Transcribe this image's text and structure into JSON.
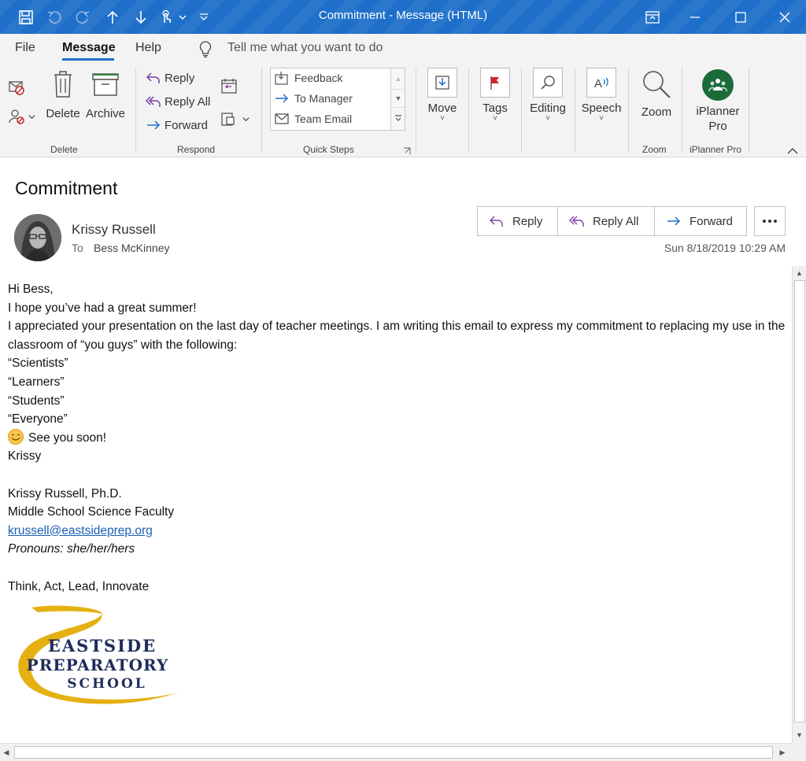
{
  "window": {
    "title": "Commitment  -  Message (HTML)",
    "accent": "#1e6fc9"
  },
  "menu": {
    "tabs": [
      "File",
      "Message",
      "Help"
    ],
    "active_tab": "Message",
    "tell_me_placeholder": "Tell me what you want to do"
  },
  "ribbon": {
    "delete_group": {
      "label": "Delete",
      "delete_label": "Delete",
      "archive_label": "Archive"
    },
    "respond_group": {
      "label": "Respond",
      "reply_label": "Reply",
      "reply_all_label": "Reply All",
      "forward_label": "Forward"
    },
    "quick_steps": {
      "label": "Quick Steps",
      "items": [
        "Feedback",
        "To Manager",
        "Team Email"
      ]
    },
    "move_label": "Move",
    "tags_label": "Tags",
    "editing_label": "Editing",
    "speech_label": "Speech",
    "zoom_label": "Zoom",
    "zoom_group_label": "Zoom",
    "iplanner_label_1": "iPlanner",
    "iplanner_label_2": "Pro",
    "iplanner_group_label": "iPlanner Pro"
  },
  "message": {
    "subject": "Commitment",
    "sender": "Krissy Russell",
    "to_label": "To",
    "to_name": "Bess McKinney",
    "date": "Sun 8/18/2019 10:29 AM",
    "actions": {
      "reply": "Reply",
      "reply_all": "Reply All",
      "forward": "Forward"
    },
    "body": {
      "line1": "Hi Bess,",
      "line2": "I hope you’ve had a great summer!",
      "line3": "I appreciated your presentation on the last day of teacher meetings. I am writing this email to express my commitment to replacing my use in the classroom of “you guys” with the following:",
      "line4": "“Scientists”",
      "line5": "“Learners”",
      "line6": "“Students”",
      "line7": "“Everyone”",
      "line8": "See you soon!",
      "line9": "Krissy",
      "sig_name": "Krissy Russell, Ph.D.",
      "sig_title": "Middle School Science Faculty",
      "sig_email": "krussell@eastsideprep.org",
      "sig_pronouns": "Pronouns: she/her/hers",
      "sig_motto": "Think, Act, Lead, Innovate"
    },
    "logo": {
      "line1": "EASTSIDE",
      "line2": "PREPARATORY",
      "line3": "SCHOOL",
      "color": "#e5b012",
      "text_color": "#1f2d5a"
    }
  }
}
